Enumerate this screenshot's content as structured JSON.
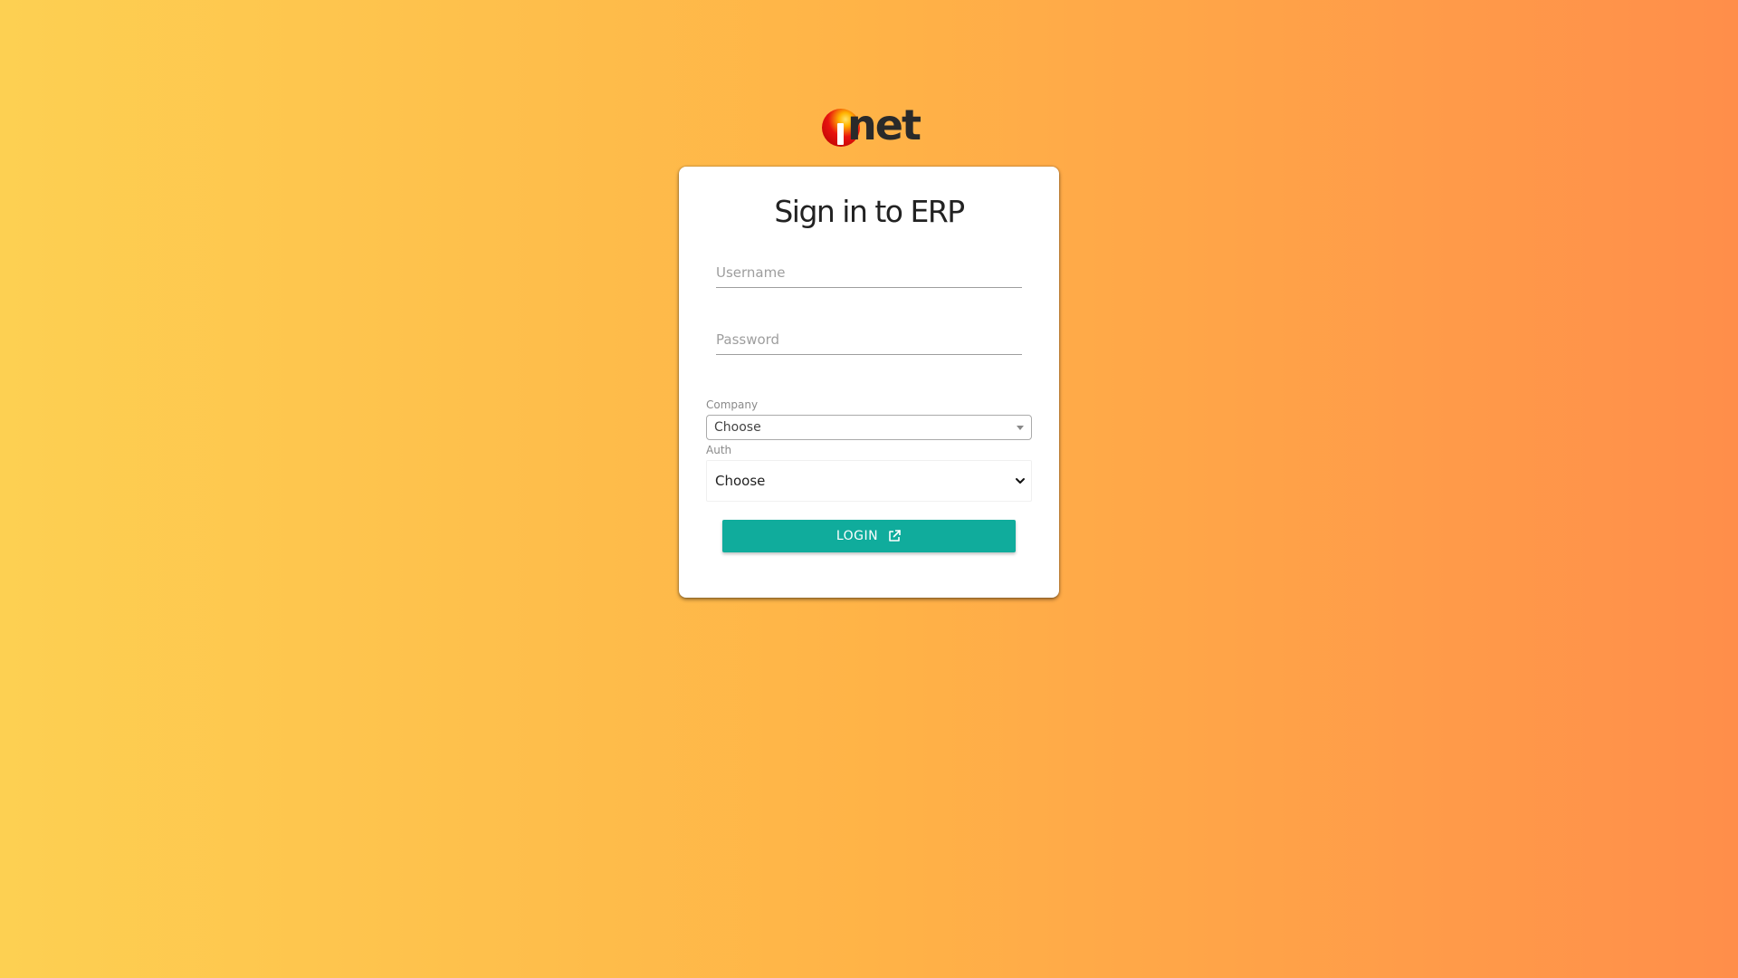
{
  "logo": {
    "text": "net",
    "ball_color": "#e8140f",
    "text_color": "#2a2a2a"
  },
  "login_card": {
    "title": "Sign in to ERP",
    "username": {
      "placeholder": "Username",
      "value": ""
    },
    "password": {
      "placeholder": "Password",
      "value": ""
    },
    "company": {
      "label": "Company",
      "selected": "Choose",
      "icon": "caret-down-icon"
    },
    "auth": {
      "label": "Auth",
      "selected": "Choose",
      "icon": "chevron-down-icon"
    },
    "login_button": {
      "label": "LOGIN",
      "icon": "external-link-icon"
    }
  },
  "colors": {
    "background_start": "#fdd052",
    "background_end": "#ff8e4a",
    "accent": "#10ac9c",
    "card": "#ffffff"
  }
}
